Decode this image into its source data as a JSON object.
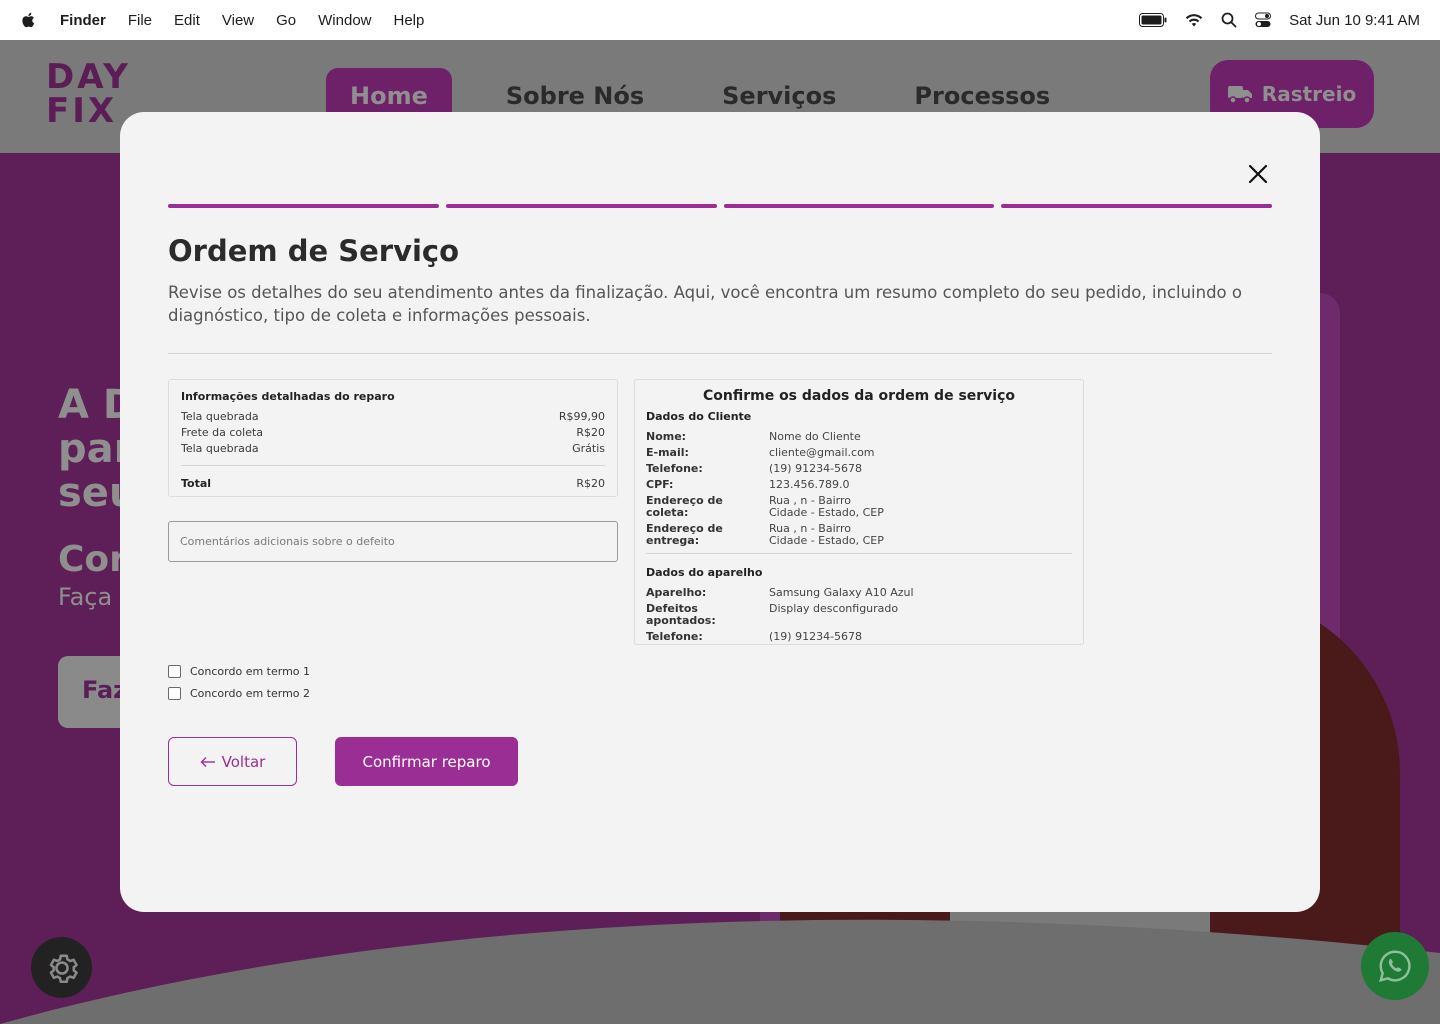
{
  "menubar": {
    "app_name": "Finder",
    "items": [
      "File",
      "Edit",
      "View",
      "Go",
      "Window",
      "Help"
    ],
    "datetime": "Sat Jun 10  9:41 AM"
  },
  "site": {
    "logo_line1": "DAY",
    "logo_line2": "FIX",
    "nav": [
      "Home",
      "Sobre Nós",
      "Serviços",
      "Processos"
    ],
    "track_label": "Rastreio",
    "hero_line1": "A D",
    "hero_line2": "par",
    "hero_line3": "seu",
    "hero_line4": "Cor",
    "hero_line5": "Faça",
    "hero_button": "Faz"
  },
  "modal": {
    "title": "Ordem de Serviço",
    "description": "Revise os detalhes do seu atendimento antes da finalização. Aqui, você encontra um resumo completo do seu pedido, incluindo o diagnóstico, tipo de coleta e informações pessoais.",
    "steps_completed": 4,
    "steps_total": 4,
    "repair_info": {
      "heading": "Informações detalhadas do reparo",
      "items": [
        {
          "label": "Tela quebrada",
          "value": "R$99,90"
        },
        {
          "label": "Frete da coleta",
          "value": "R$20"
        },
        {
          "label": "Tela quebrada",
          "value": "Grátis"
        }
      ],
      "total_label": "Total",
      "total_value": "R$20"
    },
    "comment_placeholder": "Comentários adicionais sobre o defeito",
    "confirm_card": {
      "title": "Confirme os dados da ordem de serviço",
      "client_heading": "Dados do Cliente",
      "client": {
        "name_label": "Nome:",
        "name": "Nome do Cliente",
        "email_label": "E-mail:",
        "email": "cliente@gmail.com",
        "phone_label": "Telefone:",
        "phone": "(19) 91234-5678",
        "cpf_label": "CPF:",
        "cpf": "123.456.789.0",
        "pickup_label": "Endereço de coleta:",
        "pickup_line1": "Rua , n - Bairro",
        "pickup_line2": "Cidade - Estado, CEP",
        "delivery_label": "Endereço de entrega:",
        "delivery_line1": "Rua , n - Bairro",
        "delivery_line2": "Cidade - Estado, CEP"
      },
      "device_heading": "Dados do aparelho",
      "device": {
        "device_label": "Aparelho:",
        "device": "Samsung Galaxy A10 Azul",
        "defects_label": "Defeitos apontados:",
        "defects": "Display desconfigurado",
        "phone_label": "Telefone:",
        "phone": "(19) 91234-5678"
      }
    },
    "terms": [
      "Concordo em termo 1",
      "Concordo em termo 2"
    ],
    "back_label": "Voltar",
    "confirm_label": "Confirmar reparo"
  },
  "colors": {
    "accent": "#9b2e94",
    "overlay_bg": "#5e1f59",
    "modal_bg": "#f3f3f3"
  }
}
